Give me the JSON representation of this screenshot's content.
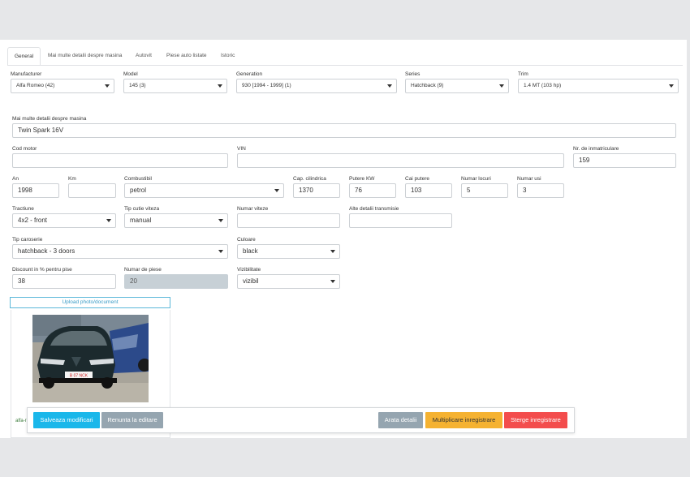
{
  "tabs": [
    "General",
    "Mai multe detalii despre masina",
    "Autovit",
    "Piese auto listate",
    "Istoric"
  ],
  "fields": {
    "manufacturer": {
      "label": "Manufacturer",
      "value": "Alfa Romeo (42)"
    },
    "model": {
      "label": "Model",
      "value": "145 (3)"
    },
    "generation": {
      "label": "Generation",
      "value": "930 [1994 - 1999] (1)"
    },
    "series": {
      "label": "Series",
      "value": "Hatchback (9)"
    },
    "trim": {
      "label": "Trim",
      "value": "1.4 MT (103 hp)"
    },
    "details": {
      "label": "Mai multe detalii despre masina",
      "value": "Twin Spark 16V"
    },
    "cod_motor": {
      "label": "Cod motor",
      "value": ""
    },
    "vin": {
      "label": "VIN",
      "value": ""
    },
    "nr_inmatriculare": {
      "label": "Nr. de inmatriculare",
      "value": "159"
    },
    "an": {
      "label": "An",
      "value": "1998"
    },
    "km": {
      "label": "Km",
      "value": ""
    },
    "combustibil": {
      "label": "Combustibil",
      "value": "petrol"
    },
    "cap_cilindrica": {
      "label": "Cap. cilindrica",
      "value": "1370"
    },
    "putere_kw": {
      "label": "Putere KW",
      "value": "76"
    },
    "cai_putere": {
      "label": "Cai putere",
      "value": "103"
    },
    "numar_locuri": {
      "label": "Numar locuri",
      "value": "5"
    },
    "numar_usi": {
      "label": "Numar usi",
      "value": "3"
    },
    "tractiune": {
      "label": "Tractiune",
      "value": "4x2 - front"
    },
    "tip_cutie": {
      "label": "Tip cutie viteza",
      "value": "manual"
    },
    "numar_viteze": {
      "label": "Numar viteze",
      "value": ""
    },
    "alte_detalii": {
      "label": "Alte detalii transmisie",
      "value": ""
    },
    "tip_caroserie": {
      "label": "Tip caroserie",
      "value": "hatchback - 3 doors"
    },
    "culoare": {
      "label": "Culoare",
      "value": "black"
    },
    "discount": {
      "label": "Discount in % pentru pise",
      "value": "38"
    },
    "numar_piese": {
      "label": "Numar de piese",
      "value": "20"
    },
    "vizibilitate": {
      "label": "Vizibilitate",
      "value": "vizibil"
    }
  },
  "upload_label": "Upload photo/document",
  "photo": {
    "plate": "B 07 NCK",
    "filename": "alfa-r"
  },
  "actions": {
    "save": "Salveaza modificari",
    "cancel": "Renunta la editare",
    "show_details": "Arata detalii",
    "multiply": "Multiplicare inregistrare",
    "delete": "Sterge inregistrare"
  },
  "colors": {
    "save": "#1ab7ea",
    "cancel": "#95a5b0",
    "show": "#95a5b0",
    "multiply": "#f5b231",
    "delete": "#f34d4d"
  }
}
